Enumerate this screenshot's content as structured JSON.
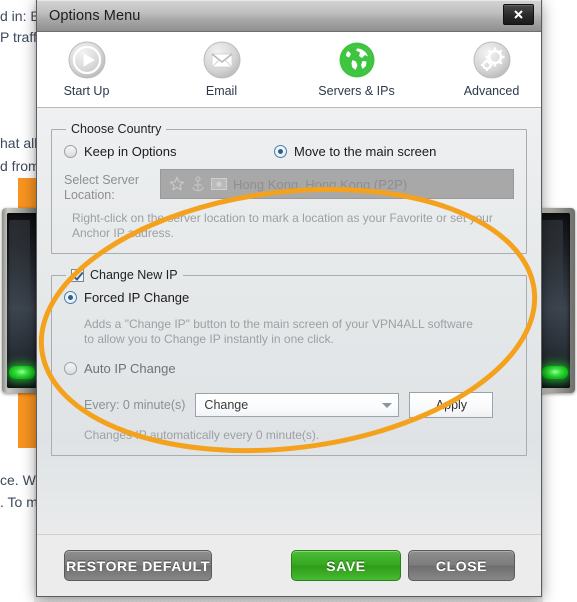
{
  "window": {
    "title": "Options Menu",
    "close_label": "x"
  },
  "toolbar": {
    "items": [
      {
        "label": "Start Up",
        "icon": "play-icon",
        "active": false
      },
      {
        "label": "Email",
        "icon": "envelope-icon",
        "active": false
      },
      {
        "label": "Servers & IPs",
        "icon": "globe-icon",
        "active": true
      },
      {
        "label": "Advanced",
        "icon": "gears-icon",
        "active": false
      }
    ]
  },
  "choose_country": {
    "legend": "Choose Country",
    "radio_keep": "Keep in Options",
    "radio_move": "Move to the main screen",
    "selected": "Move to the main screen",
    "select_server_label": "Select Server Location:",
    "server_value": "Hong Kong, Hong Kong (P2P)",
    "hint": "Right-click on the server location to mark a location as your Favorite or set your Anchor IP address."
  },
  "change_new_ip": {
    "legend": "Change New IP",
    "checked": true,
    "radio_forced": "Forced IP Change",
    "radio_auto": "Auto IP Change",
    "selected": "Forced IP Change",
    "forced_hint": "Adds a \"Change IP\" button to the main screen of your VPN4ALL software to allow you to Change IP instantly in one click.",
    "every_label": "Every: 0 minute(s)",
    "select_value": "Change",
    "apply_label": "Apply",
    "auto_hint": "Changes IP automatically every 0 minute(s)."
  },
  "footer": {
    "restore_label": "RESTORE DEFAULT",
    "save_label": "SAVE",
    "close_label": "CLOSE"
  },
  "background": {
    "text_fragments": [
      "d in: B",
      "P traff",
      "hat all",
      "d from",
      "ce. We",
      ". To m"
    ]
  },
  "colors": {
    "accent_green": "#36a81f",
    "annotation_orange": "#f4a21e",
    "orange_bar": "#f79321",
    "globe_green": "#3ec43e"
  }
}
